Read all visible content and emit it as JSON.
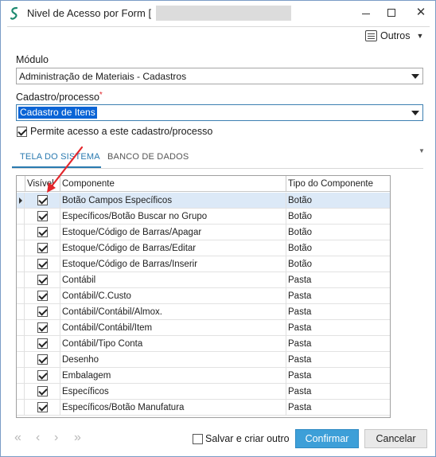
{
  "window": {
    "title": "Nivel de Acesso por Form ["
  },
  "toolbar": {
    "outros_label": "Outros"
  },
  "form": {
    "modulo_label": "Módulo",
    "modulo_value": "Administração de Materiais - Cadastros",
    "cadastro_label": "Cadastro/processo",
    "cadastro_required": "*",
    "cadastro_value": "Cadastro de Itens",
    "permite_label": "Permite acesso a este cadastro/processo",
    "permite_checked": true
  },
  "tabs": [
    {
      "label": "TELA DO SISTEMA",
      "active": true
    },
    {
      "label": "BANCO DE DADOS",
      "active": false
    }
  ],
  "grid": {
    "headers": [
      "Visível",
      "Componente",
      "Tipo do Componente"
    ],
    "rows": [
      {
        "visivel": true,
        "componente": "Botão Campos Específicos",
        "tipo": "Botão"
      },
      {
        "visivel": true,
        "componente": "Específicos/Botão Buscar no Grupo",
        "tipo": "Botão"
      },
      {
        "visivel": true,
        "componente": "Estoque/Código de Barras/Apagar",
        "tipo": "Botão"
      },
      {
        "visivel": true,
        "componente": "Estoque/Código de Barras/Editar",
        "tipo": "Botão"
      },
      {
        "visivel": true,
        "componente": "Estoque/Código de Barras/Inserir",
        "tipo": "Botão"
      },
      {
        "visivel": true,
        "componente": "Contábil",
        "tipo": "Pasta"
      },
      {
        "visivel": true,
        "componente": "Contábil/C.Custo",
        "tipo": "Pasta"
      },
      {
        "visivel": true,
        "componente": "Contábil/Contábil/Almox.",
        "tipo": "Pasta"
      },
      {
        "visivel": true,
        "componente": "Contábil/Contábil/Item",
        "tipo": "Pasta"
      },
      {
        "visivel": true,
        "componente": "Contábil/Tipo Conta",
        "tipo": "Pasta"
      },
      {
        "visivel": true,
        "componente": "Desenho",
        "tipo": "Pasta"
      },
      {
        "visivel": true,
        "componente": "Embalagem",
        "tipo": "Pasta"
      },
      {
        "visivel": true,
        "componente": "Específicos",
        "tipo": "Pasta"
      },
      {
        "visivel": true,
        "componente": "Específicos/Botão Manufatura",
        "tipo": "Pasta"
      }
    ]
  },
  "footer": {
    "nav": {
      "first": "«",
      "prev": "‹",
      "next": "›",
      "last": "»"
    },
    "salvar_label": "Salvar e criar outro",
    "confirm_label": "Confirmar",
    "cancel_label": "Cancelar"
  }
}
